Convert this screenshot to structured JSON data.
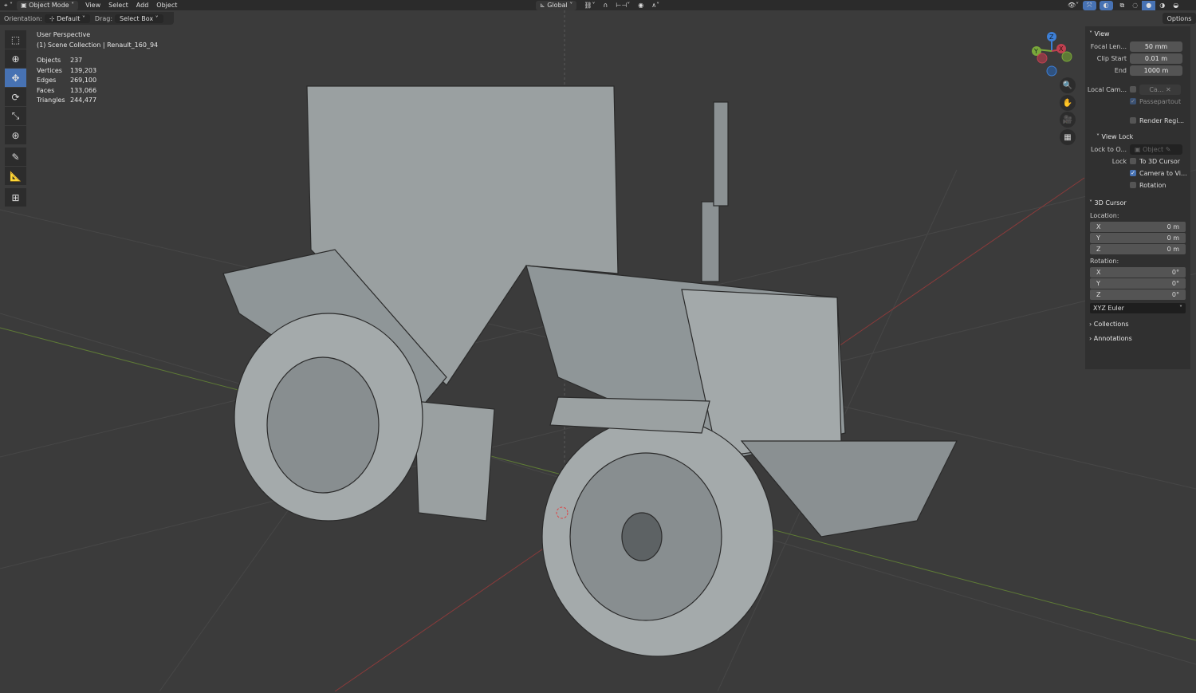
{
  "header": {
    "editor_type": "3d-viewport",
    "mode": "Object Mode",
    "menus": [
      "View",
      "Select",
      "Add",
      "Object"
    ],
    "orientation_label": "Orientation:",
    "orientation": "Default",
    "drag_label": "Drag:",
    "drag": "Select Box",
    "transform_orientation": "Global",
    "options": "Options"
  },
  "overlay": {
    "view_name": "User Perspective",
    "collection": "(1) Scene Collection | Renault_160_94",
    "stats": [
      {
        "label": "Objects",
        "value": "237"
      },
      {
        "label": "Vertices",
        "value": "139,203"
      },
      {
        "label": "Edges",
        "value": "269,100"
      },
      {
        "label": "Faces",
        "value": "133,066"
      },
      {
        "label": "Triangles",
        "value": "244,477"
      }
    ]
  },
  "gizmo": {
    "x": "X",
    "y": "Y",
    "z": "Z"
  },
  "npanel": {
    "view": {
      "title": "View",
      "focal_label": "Focal Len...",
      "focal": "50 mm",
      "clip_start_label": "Clip Start",
      "clip_start": "0.01 m",
      "end_label": "End",
      "end": "1000 m",
      "local_cam_label": "Local Cam...",
      "local_cam": "Ca...",
      "passepartout": "Passepartout",
      "render_region": "Render Regi..."
    },
    "view_lock": {
      "title": "View Lock",
      "lock_to_label": "Lock to O...",
      "lock_to_placeholder": "Object",
      "lock_label": "Lock",
      "to_cursor": "To 3D Cursor",
      "camera_to_view": "Camera to Vi...",
      "rotation": "Rotation"
    },
    "cursor": {
      "title": "3D Cursor",
      "location_label": "Location:",
      "location": [
        {
          "axis": "X",
          "value": "0 m"
        },
        {
          "axis": "Y",
          "value": "0 m"
        },
        {
          "axis": "Z",
          "value": "0 m"
        }
      ],
      "rotation_label": "Rotation:",
      "rotation": [
        {
          "axis": "X",
          "value": "0°"
        },
        {
          "axis": "Y",
          "value": "0°"
        },
        {
          "axis": "Z",
          "value": "0°"
        }
      ],
      "rotation_mode": "XYZ Euler"
    },
    "collections": "Collections",
    "annotations": "Annotations"
  }
}
